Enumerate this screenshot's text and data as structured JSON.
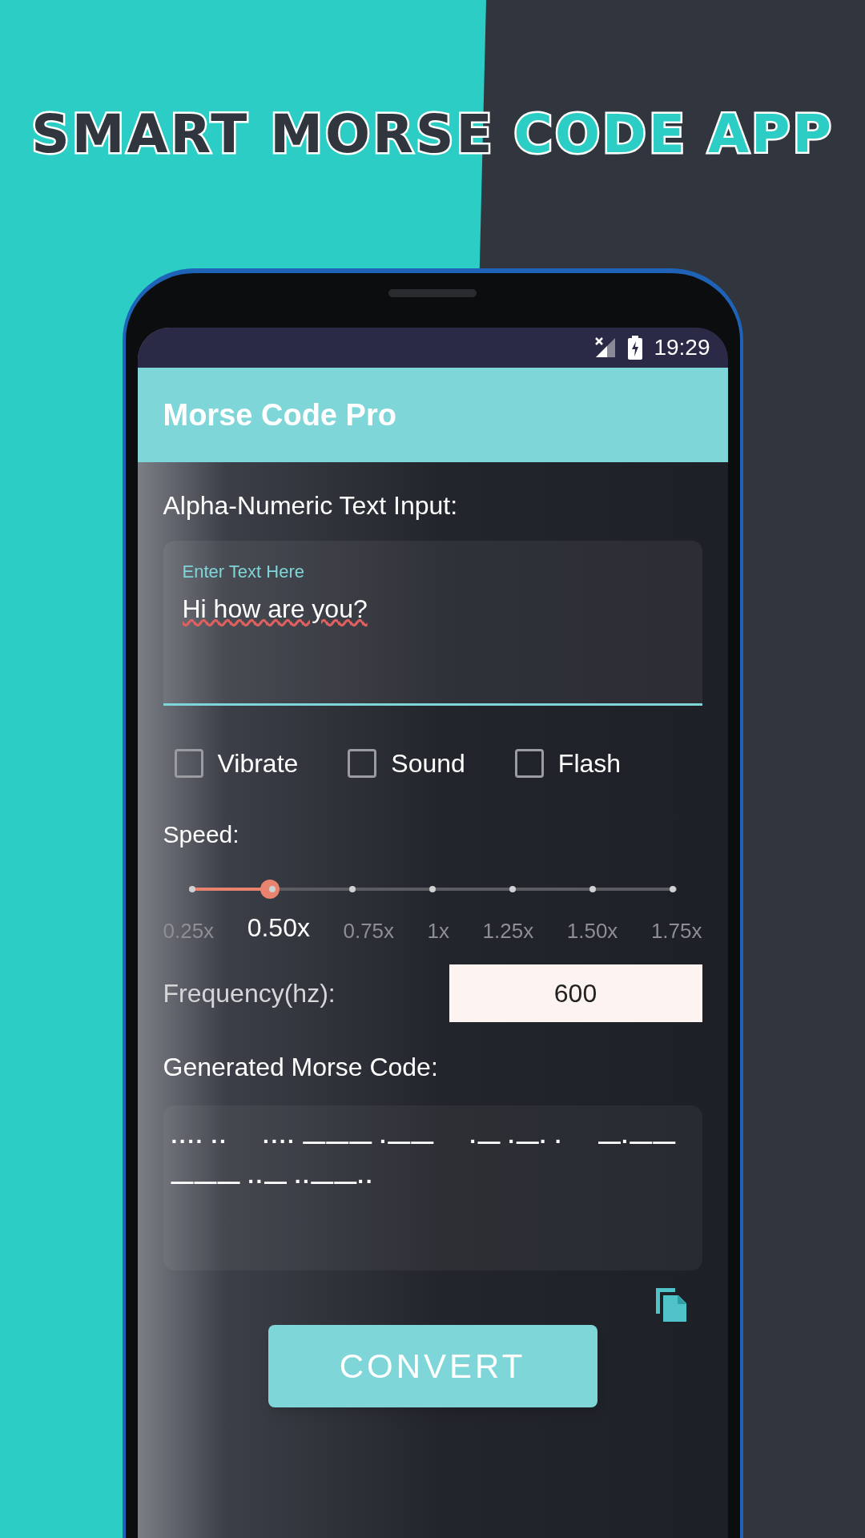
{
  "banner": {
    "title": "SMART MORSE",
    "highlight": "CODE APP"
  },
  "status_bar": {
    "time": "19:29"
  },
  "app_bar": {
    "title": "Morse Code Pro"
  },
  "input": {
    "label": "Alpha-Numeric Text Input:",
    "placeholder": "Enter Text Here",
    "value": "Hi how are you?"
  },
  "options": [
    {
      "label": "Vibrate",
      "checked": false
    },
    {
      "label": "Sound",
      "checked": false
    },
    {
      "label": "Flash",
      "checked": false
    }
  ],
  "speed": {
    "label": "Speed:",
    "level": 0.1667,
    "stops": [
      {
        "label": "0.25x",
        "selected": false
      },
      {
        "label": "0.50x",
        "selected": true
      },
      {
        "label": "0.75x",
        "selected": false
      },
      {
        "label": "1x",
        "selected": false
      },
      {
        "label": "1.25x",
        "selected": false
      },
      {
        "label": "1.50x",
        "selected": false
      },
      {
        "label": "1.75x",
        "selected": false
      }
    ]
  },
  "frequency": {
    "label": "Frequency(hz):",
    "value": "600"
  },
  "output": {
    "label": "Generated Morse Code:",
    "value": "···· ··     ···· ——— ·——     ·— ·—· ·     —·—— ——— ··— ··——··"
  },
  "convert_button": "CONVERT"
}
